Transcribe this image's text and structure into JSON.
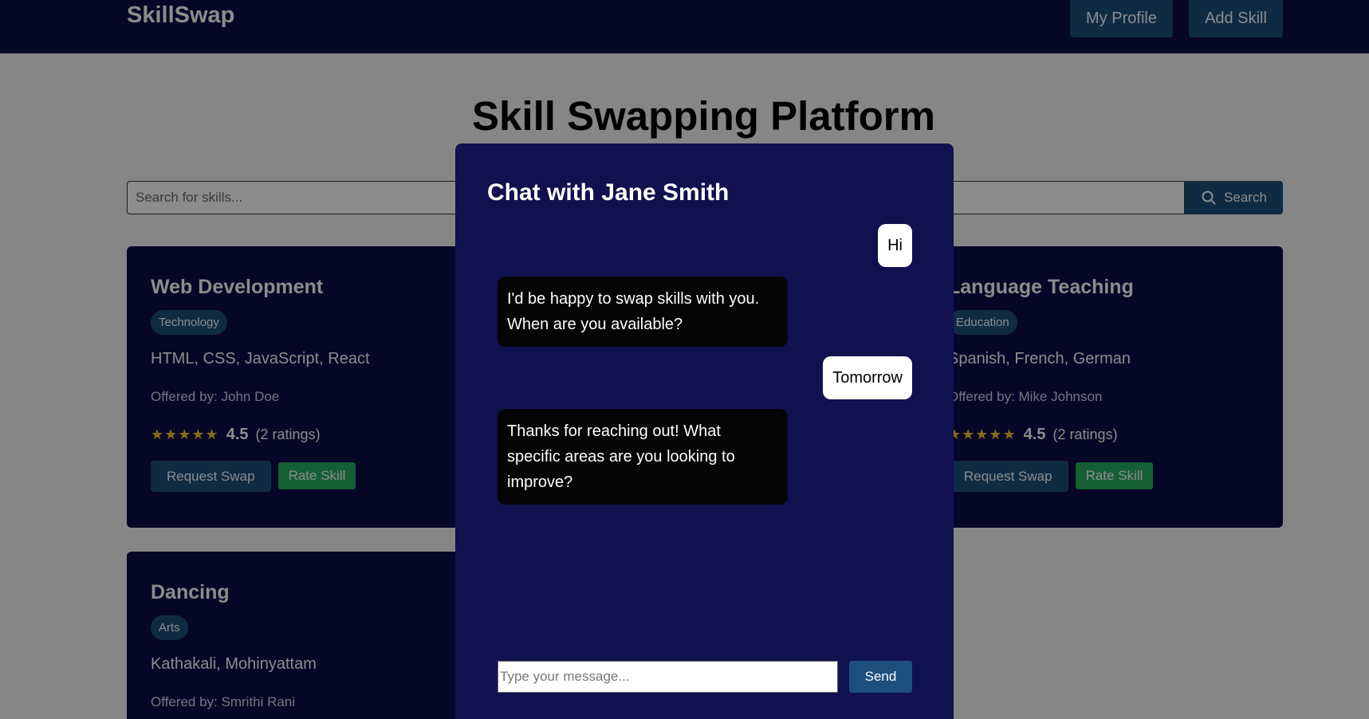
{
  "navbar": {
    "brand": "SkillSwap",
    "my_profile_label": "My Profile",
    "add_skill_label": "Add Skill"
  },
  "page": {
    "title": "Skill Swapping Platform"
  },
  "search": {
    "placeholder": "Search for skills...",
    "button_label": "Search",
    "icon": "search-icon"
  },
  "cards": [
    {
      "title": "Web Development",
      "category": "Technology",
      "skills": "HTML, CSS, JavaScript, React",
      "owner": "Offered by: John Doe",
      "stars": "★★★★★",
      "rating": "4.5",
      "rating_count": "(2 ratings)",
      "request_label": "Request Swap",
      "rate_label": "Rate Skill"
    },
    {
      "title": "Language Teaching",
      "category": "Education",
      "skills": "Spanish, French, German",
      "owner": "Offered by: Mike Johnson",
      "stars": "★★★★★",
      "rating": "4.5",
      "rating_count": "(2 ratings)",
      "request_label": "Request Swap",
      "rate_label": "Rate Skill"
    },
    {
      "title": "Dancing",
      "category": "Arts",
      "skills": "Kathakali, Mohinyattam",
      "owner": "Offered by: Smrithi Rani"
    }
  ],
  "chat": {
    "title": "Chat with Jane Smith",
    "messages": [
      {
        "direction": "sent",
        "text": "Hi"
      },
      {
        "direction": "received",
        "text": "I'd be happy to swap skills with you. When are you available?"
      },
      {
        "direction": "sent",
        "text": "Tomorrow"
      },
      {
        "direction": "received",
        "text": "Thanks for reaching out! What specific areas are you looking to improve?"
      }
    ],
    "input_placeholder": "Type your message...",
    "send_label": "Send"
  },
  "colors": {
    "navbar": "#0b0b45",
    "card": "#0b0b45",
    "modal": "#11114f",
    "primary_button": "#1d4f7d",
    "rate_button": "#27ae60",
    "star": "#f3c623"
  }
}
